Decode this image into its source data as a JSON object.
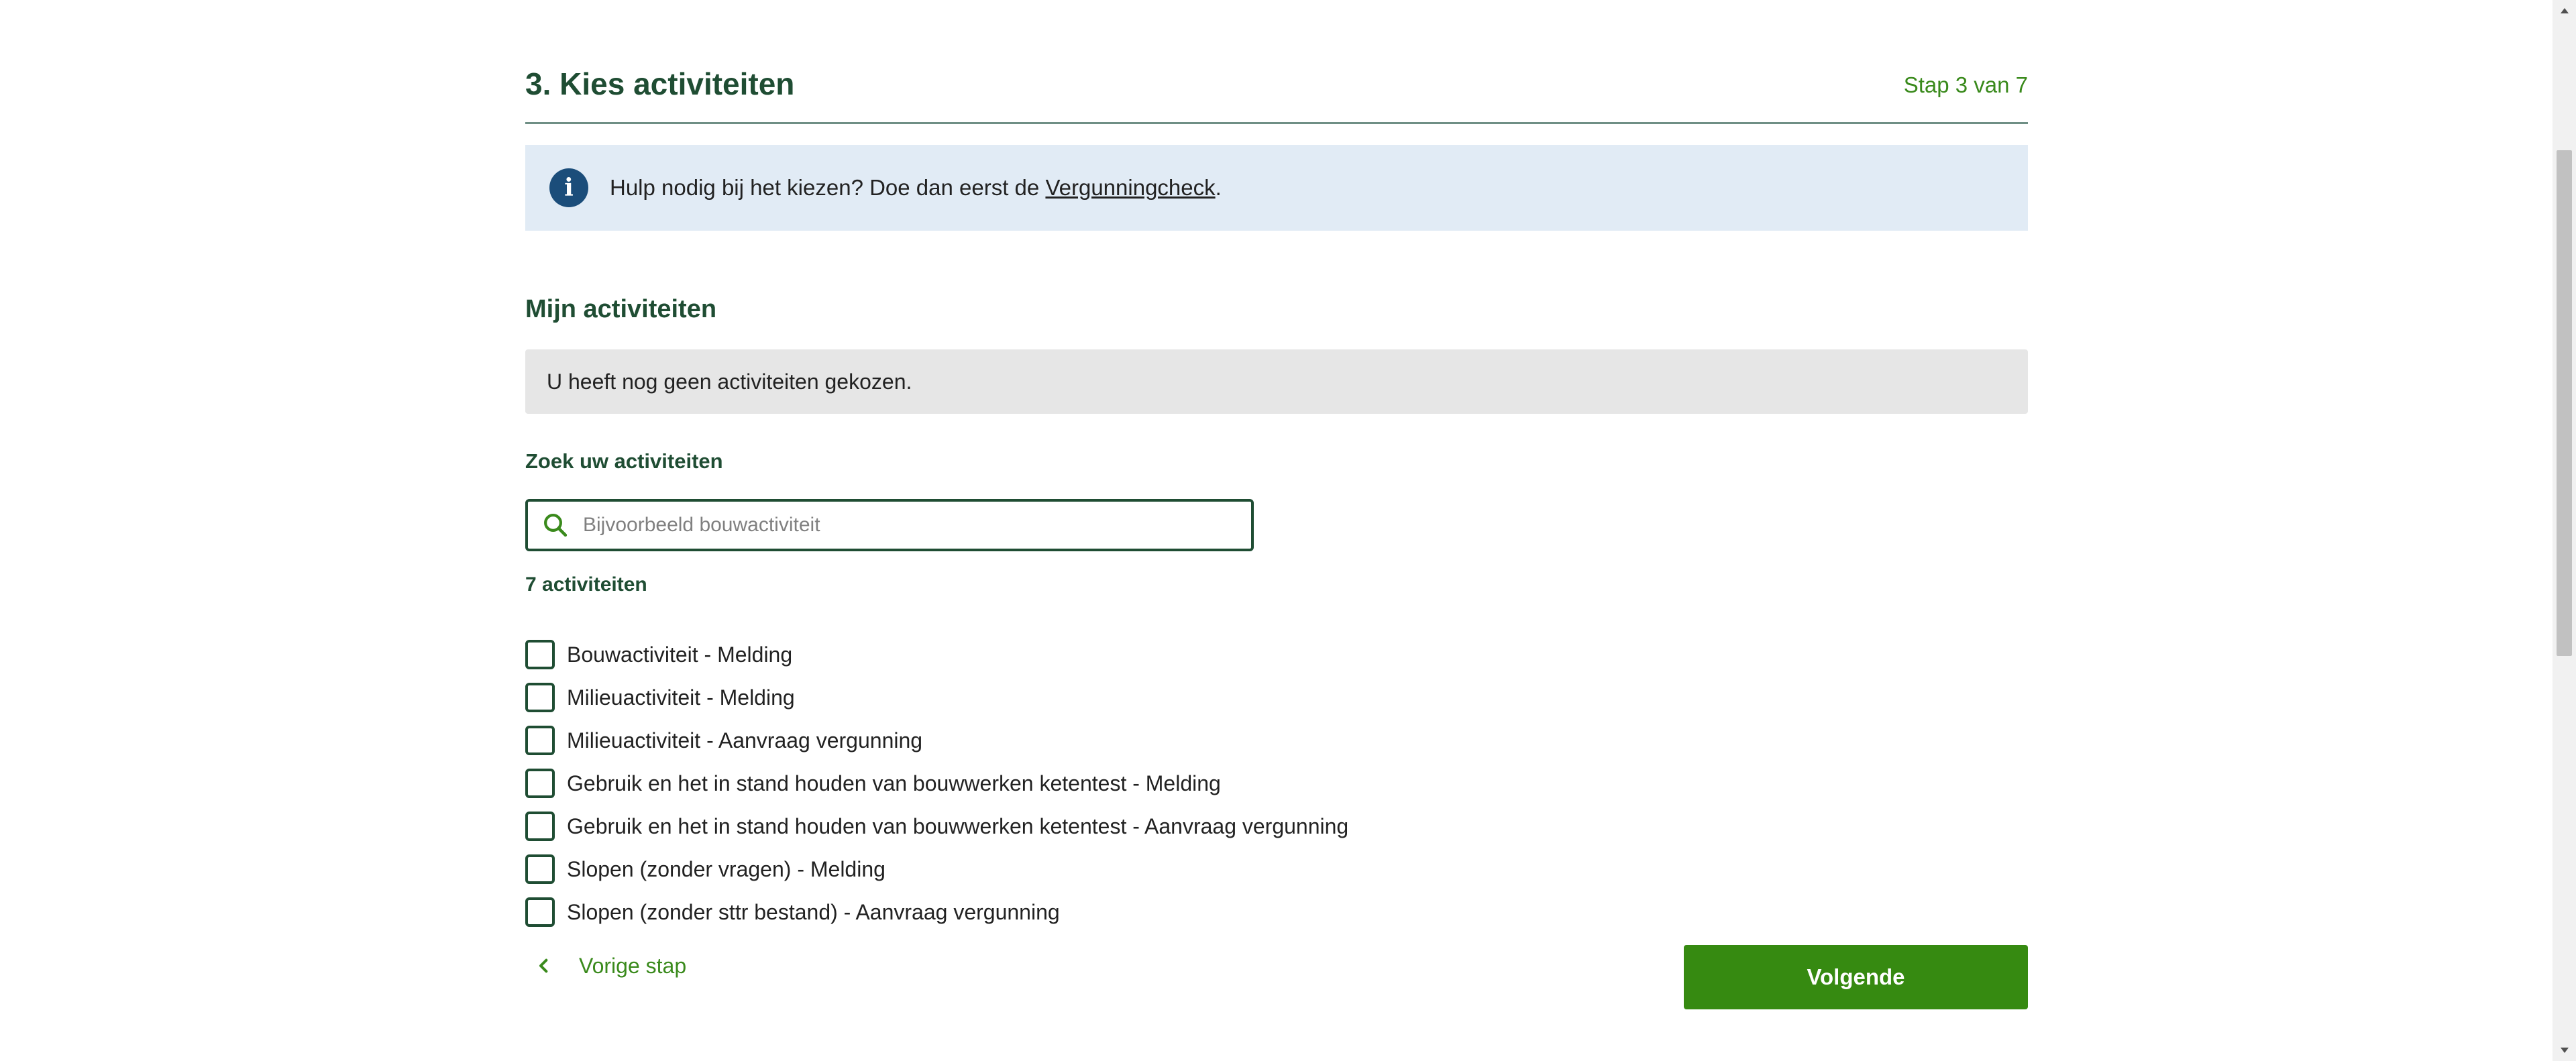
{
  "step": {
    "title": "3. Kies activiteiten",
    "counter": "Stap 3 van 7"
  },
  "info": {
    "icon": "info-icon",
    "text_before": "Hulp nodig bij het kiezen? Doe dan eerst de ",
    "link_text": "Vergunningcheck",
    "text_after": "."
  },
  "my_activities": {
    "heading": "Mijn activiteiten",
    "empty_message": "U heeft nog geen activiteiten gekozen."
  },
  "search": {
    "label": "Zoek uw activiteiten",
    "placeholder": "Bijvoorbeeld bouwactiviteit",
    "value": "",
    "icon": "search-icon"
  },
  "results": {
    "count_label": "7 activiteiten",
    "items": [
      {
        "label": "Bouwactiviteit - Melding",
        "checked": false
      },
      {
        "label": "Milieuactiviteit - Melding",
        "checked": false
      },
      {
        "label": "Milieuactiviteit - Aanvraag vergunning",
        "checked": false
      },
      {
        "label": "Gebruik en het in stand houden van bouwwerken ketentest - Melding",
        "checked": false
      },
      {
        "label": "Gebruik en het in stand houden van bouwwerken ketentest - Aanvraag vergunning",
        "checked": false
      },
      {
        "label": "Slopen (zonder vragen) - Melding",
        "checked": false
      },
      {
        "label": "Slopen (zonder sttr bestand) - Aanvraag vergunning",
        "checked": false
      }
    ]
  },
  "navigation": {
    "prev_label": "Vorige stap",
    "next_label": "Volgende"
  },
  "colors": {
    "heading_green": "#1f4d33",
    "accent_green": "#3a8a1c",
    "button_green": "#368a11",
    "info_bg": "#e1ebf5",
    "info_icon_bg": "#1b4d7a",
    "empty_bg": "#e6e6e6"
  }
}
